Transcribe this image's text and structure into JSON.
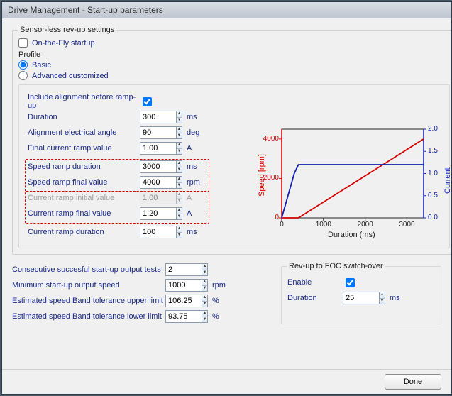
{
  "window": {
    "title": "Drive Management - Start-up parameters"
  },
  "sensorless": {
    "legend": "Sensor-less rev-up settings",
    "onTheFly_label": "On-the-Fly startup",
    "onTheFly_checked": false,
    "profile_label": "Profile",
    "basic_label": "Basic",
    "advanced_label": "Advanced customized",
    "profile_selected": "basic"
  },
  "alignment": {
    "include_label": "Include alignment before ramp-up",
    "include_checked": true,
    "duration_label": "Duration",
    "duration_value": "300",
    "duration_unit": "ms",
    "angle_label": "Alignment electrical angle",
    "angle_value": "90",
    "angle_unit": "deg",
    "final_ramp_label": "Final current ramp value",
    "final_ramp_value": "1.00",
    "final_ramp_unit": "A",
    "speed_dur_label": "Speed ramp duration",
    "speed_dur_value": "3000",
    "speed_dur_unit": "ms",
    "speed_final_label": "Speed ramp final value",
    "speed_final_value": "4000",
    "speed_final_unit": "rpm",
    "cur_init_label": "Current ramp initial value",
    "cur_init_value": "1.00",
    "cur_init_unit": "A",
    "cur_final_label": "Current ramp final value",
    "cur_final_value": "1.20",
    "cur_final_unit": "A",
    "cur_dur_label": "Current ramp duration",
    "cur_dur_value": "100",
    "cur_dur_unit": "ms"
  },
  "startup": {
    "consec_label": "Consecutive succesful start-up output tests",
    "consec_value": "2",
    "min_speed_label": "Minimum start-up output speed",
    "min_speed_value": "1000",
    "min_speed_unit": "rpm",
    "band_upper_label": "Estimated speed Band tolerance upper limit",
    "band_upper_value": "106.25",
    "band_upper_unit": "%",
    "band_lower_label": "Estimated speed Band tolerance lower limit",
    "band_lower_value": "93.75",
    "band_lower_unit": "%"
  },
  "switchover": {
    "legend": "Rev-up to FOC switch-over",
    "enable_label": "Enable",
    "enable_checked": true,
    "duration_label": "Duration",
    "duration_value": "25",
    "duration_unit": "ms"
  },
  "footer": {
    "done": "Done"
  },
  "chart_data": {
    "type": "line",
    "xlabel": "Duration (ms)",
    "ylabel_left": "Speed [rpm]",
    "ylabel_right": "Current [A]",
    "x_ticks": [
      0,
      1000,
      2000,
      3000
    ],
    "xlim": [
      0,
      3400
    ],
    "yleft_ticks": [
      0,
      2000,
      4000
    ],
    "ylim_left": [
      0,
      4500
    ],
    "yright_ticks": [
      0.0,
      0.5,
      1.0,
      1.5,
      2.0
    ],
    "ylim_right": [
      0,
      2.0
    ],
    "series": [
      {
        "name": "Speed",
        "axis": "left",
        "color": "#d30000",
        "x": [
          0,
          400,
          3400
        ],
        "y": [
          0,
          0,
          4000
        ]
      },
      {
        "name": "Current",
        "axis": "right",
        "color": "#1020b0",
        "x": [
          0,
          300,
          400,
          3400
        ],
        "y": [
          0.0,
          1.0,
          1.2,
          1.2
        ]
      }
    ]
  }
}
